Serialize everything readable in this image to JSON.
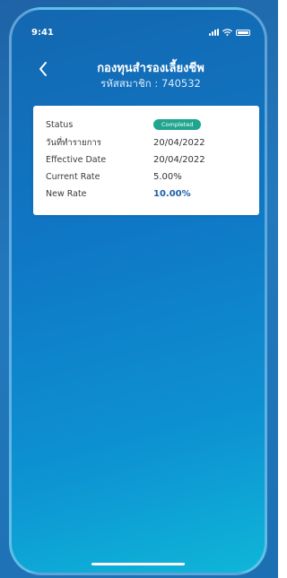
{
  "statusbar": {
    "time": "9:41",
    "icons": [
      "signal-icon",
      "wifi-icon",
      "battery-icon"
    ]
  },
  "header": {
    "back_icon": "chevron-left-icon",
    "title": "กองทุนสำรองเลี้ยงชีพ",
    "subtitle": "รหัสสมาชิก : 740532"
  },
  "details": {
    "status_label": "Status",
    "status_value": "Completed",
    "transaction_date_label": "วันที่ทำรายการ",
    "transaction_date_value": "20/04/2022",
    "effective_date_label": "Effective Date",
    "effective_date_value": "20/04/2022",
    "current_rate_label": "Current Rate",
    "current_rate_value": "5.00%",
    "new_rate_label": "New Rate",
    "new_rate_value": "10.00%"
  },
  "colors": {
    "status_badge": "#20a58e",
    "new_rate": "#1a5fa8",
    "background_top": "#1467b0",
    "background_bottom": "#0fb6d8"
  }
}
